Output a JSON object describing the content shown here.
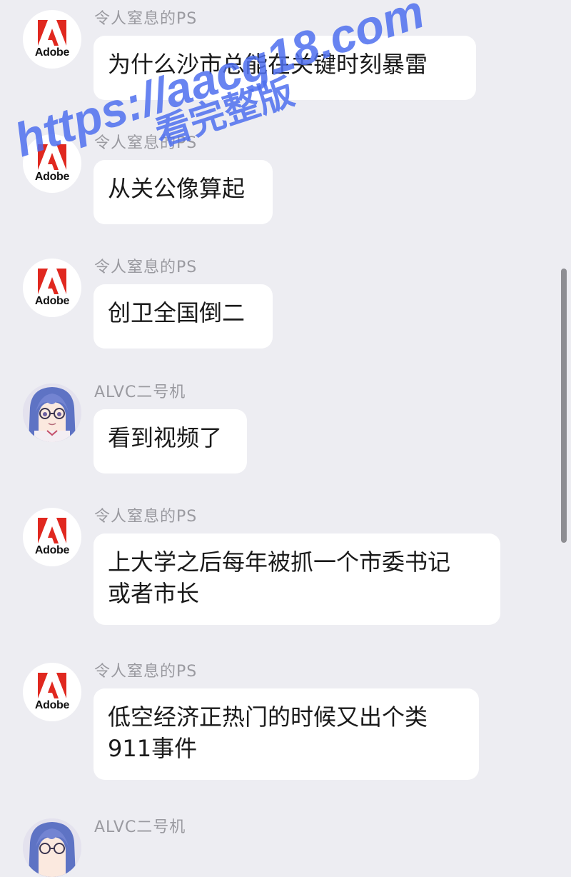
{
  "messages": [
    {
      "sender": "令人窒息的PS",
      "avatar": "adobe-logo",
      "lines": [
        "为什么沙市总能在关键时刻暴雷"
      ]
    },
    {
      "sender": "令人窒息的PS",
      "avatar": "adobe-logo",
      "lines": [
        "从关公像算起"
      ]
    },
    {
      "sender": "令人窒息的PS",
      "avatar": "adobe-logo",
      "lines": [
        "创卫全国倒二"
      ]
    },
    {
      "sender": "ALVC二号机",
      "avatar": "anime-avatar",
      "lines": [
        "看到视频了"
      ]
    },
    {
      "sender": "令人窒息的PS",
      "avatar": "adobe-logo",
      "lines": [
        "上大学之后每年被抓一个市委书记",
        "或者市长"
      ]
    },
    {
      "sender": "令人窒息的PS",
      "avatar": "adobe-logo",
      "lines": [
        "低空经济正热门的时候又出个类",
        "911事件"
      ]
    },
    {
      "sender": "ALVC二号机",
      "avatar": "anime-avatar",
      "lines": []
    }
  ],
  "logo_text": "Adobe",
  "watermark": {
    "line1": "https://aacg18.com",
    "line2": "看完整版",
    "color": "#4d6fee"
  },
  "colors": {
    "background": "#ededf2",
    "bubble": "#ffffff",
    "sender": "#9a9aa0",
    "adobe_red": "#e0281f"
  }
}
